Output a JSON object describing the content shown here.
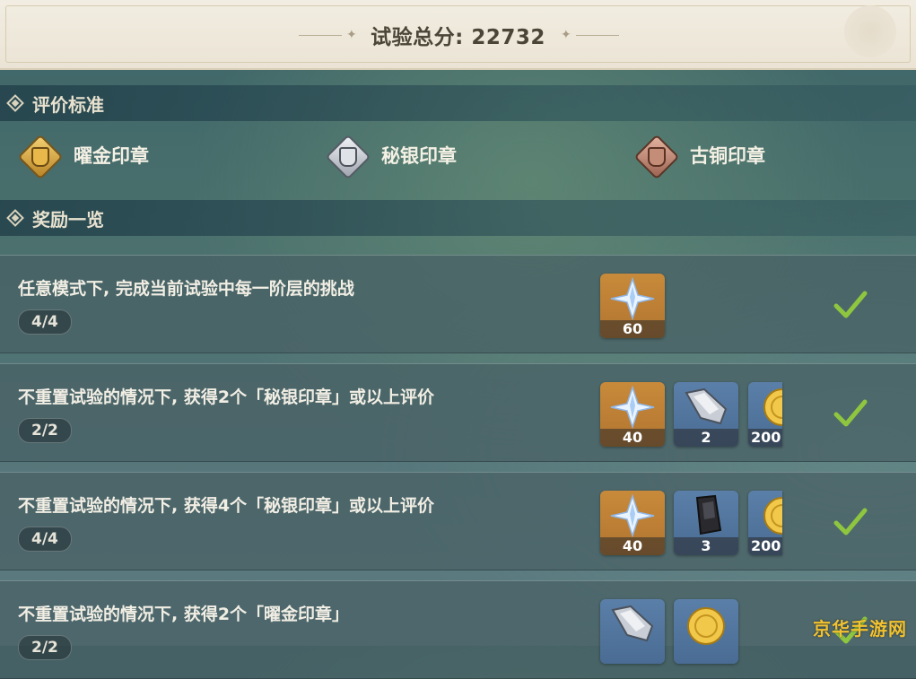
{
  "header": {
    "title": "试验总分: 22732"
  },
  "criteria": {
    "title": "评价标准",
    "grades": [
      {
        "label": "曜金印章",
        "icon": "gold-seal-icon",
        "color": "#d4a13f"
      },
      {
        "label": "秘银印章",
        "icon": "silver-seal-icon",
        "color": "#c9ccd2"
      },
      {
        "label": "古铜印章",
        "icon": "bronze-seal-icon",
        "color": "#b07a64"
      }
    ]
  },
  "rewards": {
    "title": "奖励一览",
    "rows": [
      {
        "text": "任意模式下, 完成当前试验中每一阶层的挑战",
        "progress": "4/4",
        "completed": true,
        "items": [
          {
            "icon": "primogem-icon",
            "count": "60"
          }
        ]
      },
      {
        "text": "不重置试验的情况下, 获得2个「秘银印章」或以上评价",
        "progress": "2/2",
        "completed": true,
        "items": [
          {
            "icon": "primogem-icon",
            "count": "40"
          },
          {
            "icon": "weapon-ore-icon",
            "count": "2"
          },
          {
            "icon": "mora-coin-icon",
            "count": "200"
          }
        ]
      },
      {
        "text": "不重置试验的情况下, 获得4个「秘银印章」或以上评价",
        "progress": "4/4",
        "completed": true,
        "items": [
          {
            "icon": "primogem-icon",
            "count": "40"
          },
          {
            "icon": "dark-ore-icon",
            "count": "3"
          },
          {
            "icon": "mora-coin-icon",
            "count": "200"
          }
        ]
      },
      {
        "text": "不重置试验的情况下, 获得2个「曜金印章」",
        "progress": "2/2",
        "completed": true,
        "items": [
          {
            "icon": "weapon-ore-icon",
            "count": ""
          },
          {
            "icon": "mora-coin-icon",
            "count": ""
          }
        ]
      }
    ]
  },
  "watermark": "京华手游网",
  "colors": {
    "header_bg": "#efe9dd",
    "check_green": "#8ec63f",
    "primogem_bg": "#c0843a",
    "material_bg": "#5577a0"
  }
}
